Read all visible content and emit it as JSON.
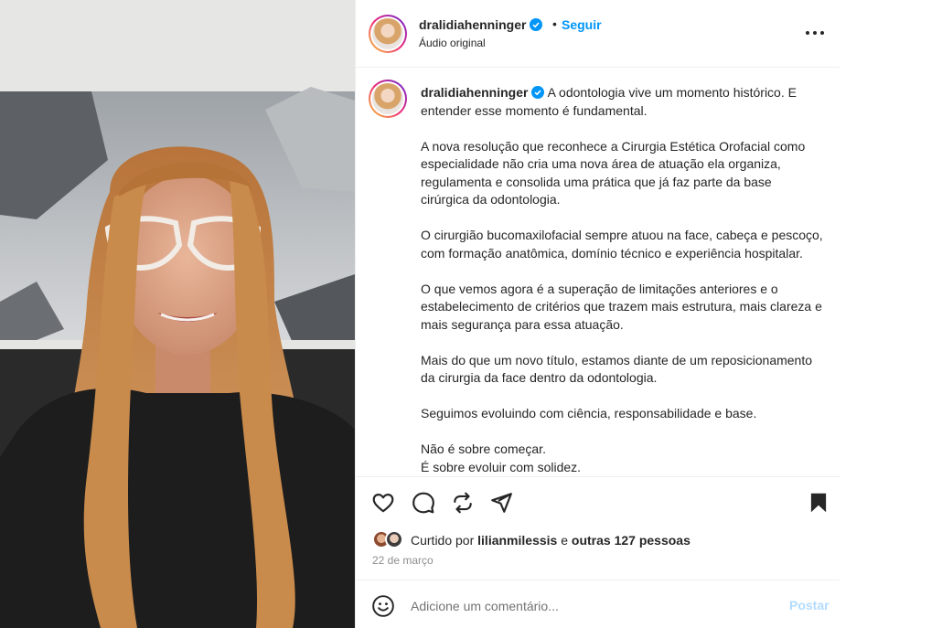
{
  "post": {
    "username": "dralidiahenninger",
    "separator": "•",
    "follow_label": "Seguir",
    "audio_label": "Áudio original",
    "more_icon": "more-options-icon"
  },
  "caption": {
    "username": "dralidiahenninger",
    "paragraphs": [
      "A odontologia vive um momento histórico. E entender esse momento é fundamental.",
      "A nova resolução que reconhece a Cirurgia Estética Orofacial como especialidade não cria uma nova área de atuação ela organiza, regulamenta e consolida uma prática que já faz parte da base cirúrgica da odontologia.",
      "O cirurgião bucomaxilofacial sempre atuou na face, cabeça e pescoço, com formação anatômica, domínio técnico e experiência hospitalar.",
      "O que vemos agora é a superação de limitações anteriores e o estabelecimento de critérios que trazem mais estrutura, mais clareza e mais segurança para essa atuação.",
      "Mais do que um novo título, estamos diante de um reposicionamento da cirurgia da face dentro da odontologia.",
      "Seguimos evoluindo com ciência, responsabilidade e base.",
      "Não é sobre começar.",
      "É sobre evoluir com solidez."
    ]
  },
  "actions": {
    "like_icon": "heart-icon",
    "comment_icon": "comment-icon",
    "share_icon": "repost-icon",
    "send_icon": "send-icon",
    "save_icon": "bookmark-icon"
  },
  "likes": {
    "prefix": "Curtido por",
    "user": "lilianmilessis",
    "connector": "e",
    "others": "outras 127 pessoas"
  },
  "date": "22 de março",
  "comment": {
    "placeholder": "Adicione um comentário...",
    "post_label": "Postar",
    "emoji_icon": "emoji-icon"
  },
  "colors": {
    "accent": "#0095f6",
    "post_disabled": "#b3dbff",
    "verified": "#0095f6",
    "text": "#262626",
    "secondary": "#8e8e8e"
  }
}
